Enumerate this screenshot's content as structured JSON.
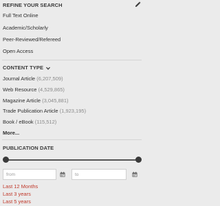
{
  "refine": {
    "title": "REFINE YOUR SEARCH",
    "edit_icon": "pencil-icon",
    "options": [
      {
        "label": "Full Text Online"
      },
      {
        "label": "Academic/Scholarly"
      },
      {
        "label": "Peer-Reviewed/Refereed"
      },
      {
        "label": "Open Access"
      }
    ]
  },
  "content_type": {
    "title": "CONTENT TYPE",
    "toggle_icon": "chevron-down-icon",
    "items": [
      {
        "label": "Journal Article",
        "count": "(6,207,509)"
      },
      {
        "label": "Web Resource",
        "count": "(4,529,865)"
      },
      {
        "label": "Magazine Article",
        "count": "(3,045,881)"
      },
      {
        "label": "Trade Publication Article",
        "count": "(1,923,195)"
      },
      {
        "label": "Book / eBook",
        "count": "(115,512)"
      }
    ],
    "more_label": "More..."
  },
  "publication_date": {
    "title": "PUBLICATION DATE",
    "from_placeholder": "from",
    "to_placeholder": "to",
    "calendar_icon": "calendar-icon",
    "range_selected": [
      0.0,
      1.0
    ],
    "quick_links": [
      {
        "label": "Last 12 Months"
      },
      {
        "label": "Last 3 years"
      },
      {
        "label": "Last 5 years"
      }
    ]
  },
  "colors": {
    "background": "#ebebeb",
    "link_red": "#c0392b",
    "count_gray": "#8a8a8a"
  }
}
